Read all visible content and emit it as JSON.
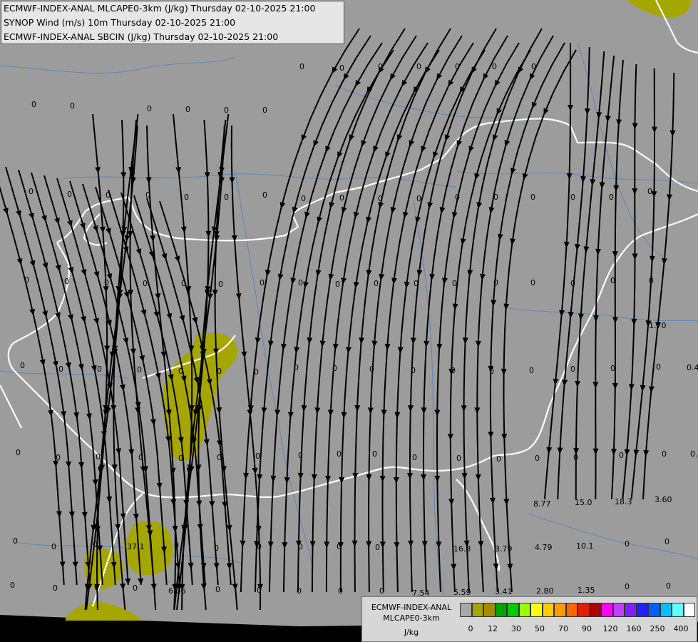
{
  "header": {
    "line1": "ECMWF-INDEX-ANAL MLCAPE0-3km (J/kg) Thursday 02-10-2025 21:00",
    "line2": "SYNOP Wind (m/s) 10m Thursday 02-10-2025 21:00",
    "line3": "ECMWF-INDEX-ANAL SBCIN (J/kg) Thursday 02-10-2025 21:00"
  },
  "legend": {
    "name_line1": "ECMWF-INDEX-ANAL",
    "name_line2": "MLCAPE0-3km",
    "unit": "J/kg",
    "colors": [
      "#a9a9a9",
      "#a6a600",
      "#a68a00",
      "#00a600",
      "#00cc00",
      "#99ff00",
      "#ffff00",
      "#ffcc00",
      "#ff9900",
      "#ff6600",
      "#e02000",
      "#b00000",
      "#ff00ff",
      "#c040ff",
      "#8020ff",
      "#2020ff",
      "#0060ff",
      "#00c0ff",
      "#60ffff",
      "#ffffff"
    ],
    "ticks": [
      "0",
      "12",
      "30",
      "50",
      "70",
      "90",
      "120",
      "160",
      "250",
      "400"
    ]
  },
  "colors": {
    "background": "#9c9c9c",
    "border": "#ffffff",
    "river": "#5f87b7",
    "cape_low": "#a6a600",
    "streamline": "#000000"
  },
  "cin_labels": [
    "0",
    "0",
    "0",
    "0",
    "0",
    "0",
    "0",
    "0",
    "0",
    "0",
    "0",
    "0",
    "0",
    "0",
    "0",
    "0",
    "0",
    "0",
    "0",
    "0",
    "1.70",
    "0.4",
    "0.",
    "3.60",
    "18.3",
    "15.0",
    "8.77",
    "4.79",
    "10.1",
    "1.35",
    "2.80",
    "3.41",
    "5.59",
    "7.54",
    "16.3",
    "3.79",
    "37.1",
    "6.06"
  ]
}
